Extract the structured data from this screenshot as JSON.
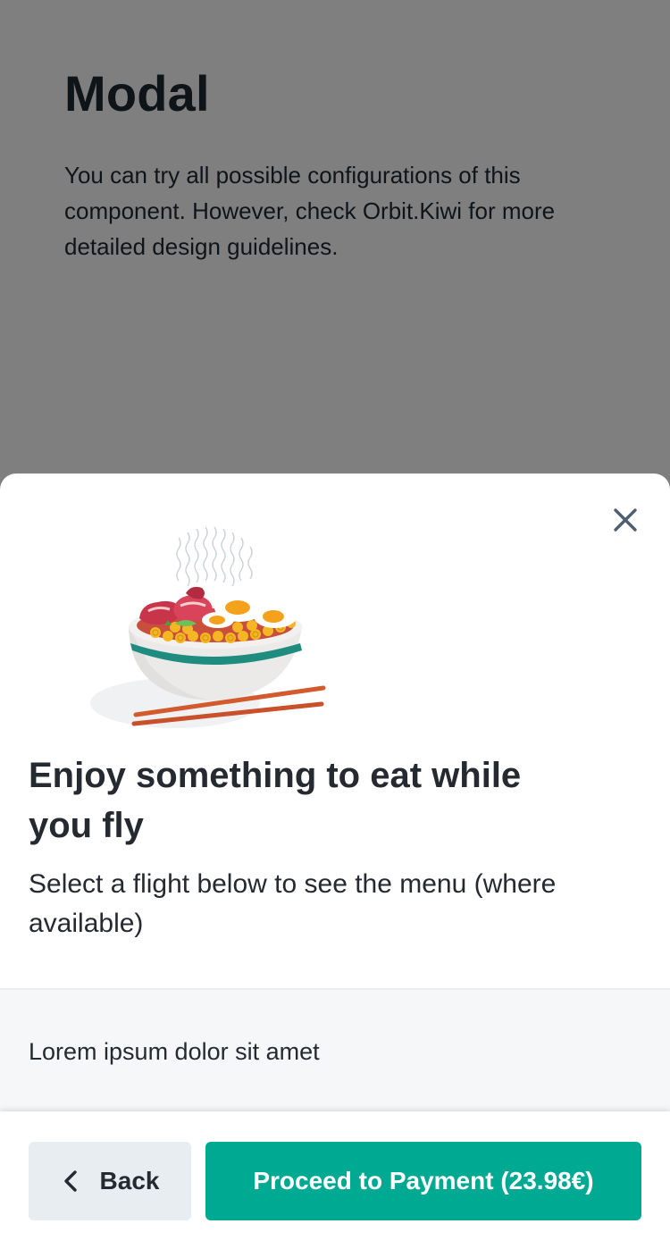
{
  "background_page": {
    "title": "Modal",
    "description": "You can try all possible configurations of this component. However, check Orbit.Kiwi for more detailed design guidelines."
  },
  "modal": {
    "close_icon": "close-icon",
    "illustration": "noodle-bowl-illustration",
    "title": "Enjoy something to eat while you fly",
    "description": "Select a flight below to see the menu (where available)",
    "section_text": "Lorem ipsum dolor sit amet",
    "footer": {
      "back_label": "Back",
      "back_icon": "chevron-left-icon",
      "proceed_label": "Proceed to Payment (23.98€)"
    }
  },
  "colors": {
    "primary": "#00a991",
    "text": "#252a31",
    "secondary_button": "#e8edf1",
    "section_background": "#f5f7f9",
    "overlay": "rgba(0,0,0,0.5)"
  }
}
